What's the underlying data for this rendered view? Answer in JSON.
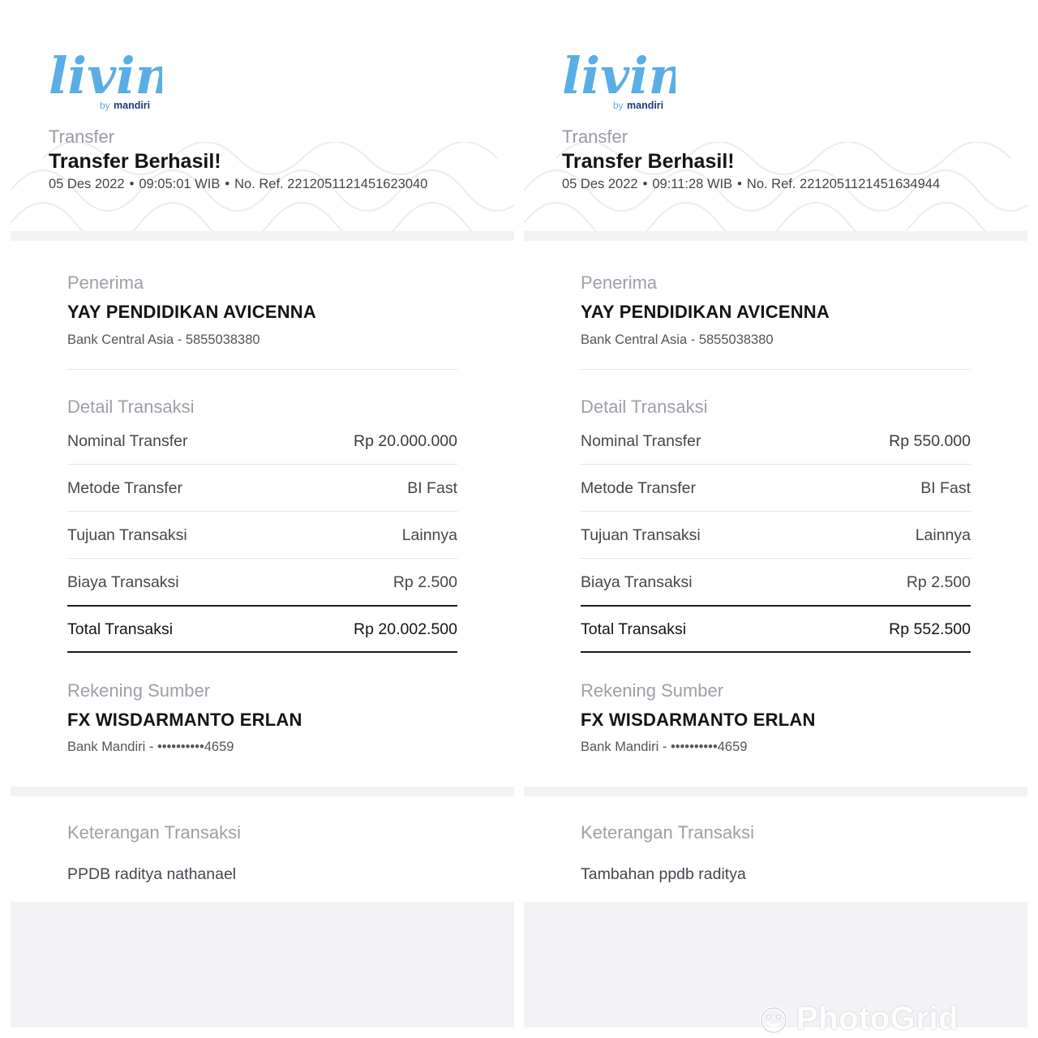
{
  "colors": {
    "logo_blue": "#5aaee6",
    "logo_dark": "#1d3c78",
    "logo_yellow": "#f4b400",
    "band_gray": "#f3f3f6"
  },
  "receipts": [
    {
      "logo": {
        "word": "livin'",
        "by": "by",
        "brand": "mandiri"
      },
      "header": {
        "label": "Transfer",
        "title": "Transfer Berhasil!",
        "date": "05 Des 2022",
        "time": "09:05:01 WIB",
        "ref": "No. Ref. 2212051121451623040"
      },
      "recipient": {
        "label": "Penerima",
        "name": "YAY PENDIDIKAN AVICENNA",
        "bank": "Bank Central Asia - 5855038380"
      },
      "details": {
        "label": "Detail Transaksi",
        "nominal_label": "Nominal Transfer",
        "nominal_value": "Rp 20.000.000",
        "method_label": "Metode Transfer",
        "method_value": "BI Fast",
        "purpose_label": "Tujuan Transaksi",
        "purpose_value": "Lainnya",
        "fee_label": "Biaya Transaksi",
        "fee_value": "Rp 2.500",
        "total_label": "Total Transaksi",
        "total_value": "Rp 20.002.500"
      },
      "source": {
        "label": "Rekening Sumber",
        "name": "FX WISDARMANTO ERLAN",
        "bank": "Bank Mandiri - ••••••••••4659"
      },
      "note": {
        "label": "Keterangan Transaksi",
        "text": "PPDB raditya nathanael"
      }
    },
    {
      "logo": {
        "word": "livin'",
        "by": "by",
        "brand": "mandiri"
      },
      "header": {
        "label": "Transfer",
        "title": "Transfer Berhasil!",
        "date": "05 Des 2022",
        "time": "09:11:28 WIB",
        "ref": "No. Ref. 2212051121451634944"
      },
      "recipient": {
        "label": "Penerima",
        "name": "YAY PENDIDIKAN AVICENNA",
        "bank": "Bank Central Asia - 5855038380"
      },
      "details": {
        "label": "Detail Transaksi",
        "nominal_label": "Nominal Transfer",
        "nominal_value": "Rp 550.000",
        "method_label": "Metode Transfer",
        "method_value": "BI Fast",
        "purpose_label": "Tujuan Transaksi",
        "purpose_value": "Lainnya",
        "fee_label": "Biaya Transaksi",
        "fee_value": "Rp 2.500",
        "total_label": "Total Transaksi",
        "total_value": "Rp 552.500"
      },
      "source": {
        "label": "Rekening Sumber",
        "name": "FX WISDARMANTO ERLAN",
        "bank": "Bank Mandiri - ••••••••••4659"
      },
      "note": {
        "label": "Keterangan Transaksi",
        "text": "Tambahan ppdb raditya"
      }
    }
  ],
  "watermark": {
    "text": "PhotoGrid",
    "icon": "photogrid-smile-icon"
  }
}
